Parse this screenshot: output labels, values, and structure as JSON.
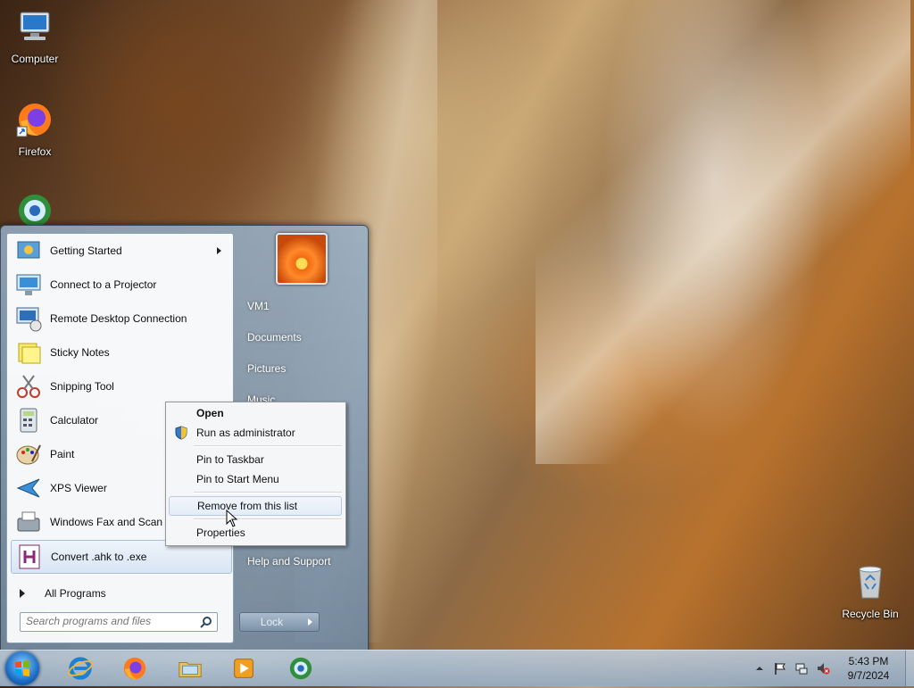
{
  "desktop": {
    "icons": [
      {
        "label": "Computer"
      },
      {
        "label": "Firefox"
      },
      {
        "label": "Recycle Bin"
      }
    ]
  },
  "start_menu": {
    "programs": [
      {
        "label": "Getting Started",
        "icon": "getting-started-icon",
        "has_submenu": true
      },
      {
        "label": "Connect to a Projector",
        "icon": "projector-icon"
      },
      {
        "label": "Remote Desktop Connection",
        "icon": "remote-desktop-icon"
      },
      {
        "label": "Sticky Notes",
        "icon": "sticky-notes-icon"
      },
      {
        "label": "Snipping Tool",
        "icon": "scissors-icon"
      },
      {
        "label": "Calculator",
        "icon": "calculator-icon"
      },
      {
        "label": "Paint",
        "icon": "paint-palette-icon"
      },
      {
        "label": "XPS Viewer",
        "icon": "xps-viewer-icon"
      },
      {
        "label": "Windows Fax and Scan",
        "icon": "fax-scan-icon"
      },
      {
        "label": "Convert .ahk to .exe",
        "icon": "ahk-h-icon",
        "highlighted": true
      }
    ],
    "all_programs": "All Programs",
    "search_placeholder": "Search programs and files",
    "right_items": [
      "VM1",
      "Documents",
      "Pictures",
      "Music",
      "Help and Support"
    ],
    "lock_label": "Lock"
  },
  "context_menu": {
    "items": [
      {
        "label": "Open",
        "bold": true
      },
      {
        "label": "Run as administrator",
        "icon": "uac-shield-icon"
      },
      {
        "label": "Pin to Taskbar"
      },
      {
        "label": "Pin to Start Menu"
      },
      {
        "label": "Remove from this list",
        "hovered": true
      },
      {
        "label": "Properties"
      }
    ]
  },
  "taskbar": {
    "pinned": [
      "internet-explorer-icon",
      "firefox-icon",
      "file-explorer-icon",
      "media-player-icon",
      "remote-app-icon"
    ],
    "clock": {
      "time": "5:43 PM",
      "date": "9/7/2024"
    }
  }
}
